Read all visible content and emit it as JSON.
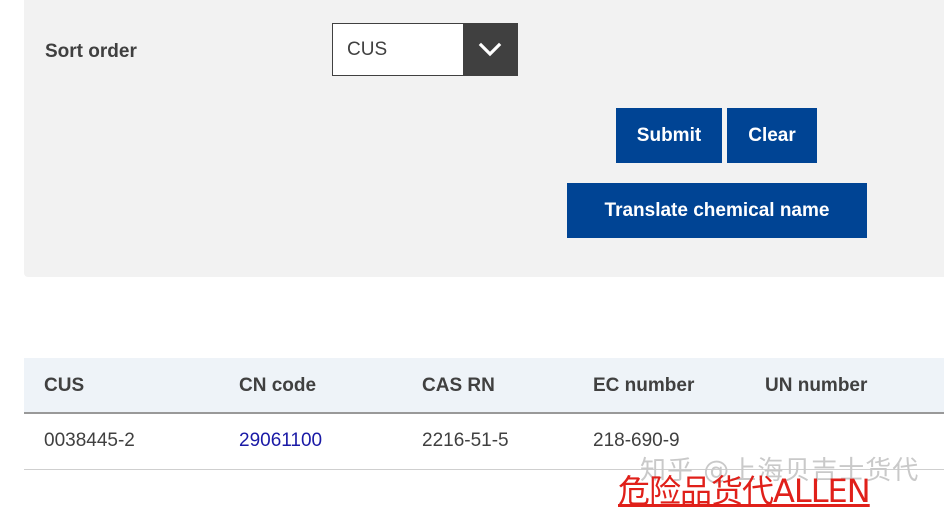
{
  "form": {
    "sort_label": "Sort order",
    "sort_value": "CUS",
    "submit_label": "Submit",
    "clear_label": "Clear",
    "translate_label": "Translate chemical name"
  },
  "table": {
    "headers": [
      "CUS",
      "CN code",
      "CAS RN",
      "EC number",
      "UN number"
    ],
    "rows": [
      {
        "cus": "0038445-2",
        "cn_code": "29061100",
        "cas_rn": "2216-51-5",
        "ec_number": "218-690-9",
        "un_number": ""
      }
    ]
  },
  "watermark": {
    "line1": "知乎 @上海贝吉士货代",
    "line2": "危险品货代ALLEN"
  },
  "colors": {
    "primary_button": "#004494",
    "panel_bg": "#f2f2f2",
    "header_bg": "#eef3f8",
    "link": "#1a1aa6",
    "watermark_red": "#e0201a"
  }
}
